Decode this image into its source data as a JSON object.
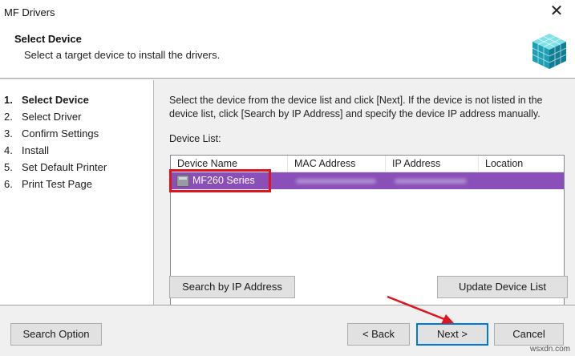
{
  "window": {
    "title": "MF Drivers",
    "close_glyph": "✕"
  },
  "header": {
    "title": "Select Device",
    "subtitle": "Select a target device to install the drivers."
  },
  "steps": [
    {
      "num": "1.",
      "label": "Select Device",
      "active": true
    },
    {
      "num": "2.",
      "label": "Select Driver"
    },
    {
      "num": "3.",
      "label": "Confirm Settings"
    },
    {
      "num": "4.",
      "label": "Install"
    },
    {
      "num": "5.",
      "label": "Set Default Printer"
    },
    {
      "num": "6.",
      "label": "Print Test Page"
    }
  ],
  "main": {
    "instructions": "Select the device from the device list and click [Next]. If the device is not listed in the device list, click [Search by IP Address] and specify the device IP address manually.",
    "device_list_label": "Device List:",
    "columns": [
      "Device Name",
      "MAC Address",
      "IP Address",
      "Location"
    ],
    "rows": [
      {
        "name": "MF260 Series",
        "mac": "",
        "ip": "",
        "location": ""
      }
    ]
  },
  "buttons": {
    "search_ip": "Search by IP Address",
    "update_list": "Update Device List",
    "search_option": "Search Option",
    "back": "< Back",
    "next": "Next >",
    "cancel": "Cancel"
  },
  "watermark": "wsxdn.com",
  "colors": {
    "selection": "#8a4fb8",
    "highlight_box": "#e0141c",
    "focus_border": "#0078d7"
  }
}
